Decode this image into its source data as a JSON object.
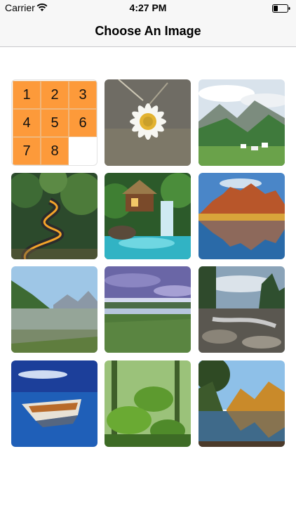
{
  "status_bar": {
    "carrier": "Carrier",
    "time": "4:27 PM"
  },
  "nav": {
    "title": "Choose An Image"
  },
  "puzzle": {
    "tiles": [
      "1",
      "2",
      "3",
      "4",
      "5",
      "6",
      "7",
      "8"
    ]
  },
  "images": [
    {
      "name": "daisy"
    },
    {
      "name": "alpine-valley"
    },
    {
      "name": "winding-road"
    },
    {
      "name": "waterfall-hut"
    },
    {
      "name": "red-rocks-lake"
    },
    {
      "name": "mountain-lake"
    },
    {
      "name": "cloudy-marsh"
    },
    {
      "name": "rocky-stream"
    },
    {
      "name": "boat"
    },
    {
      "name": "mossy-rocks"
    },
    {
      "name": "autumn-lake"
    }
  ]
}
